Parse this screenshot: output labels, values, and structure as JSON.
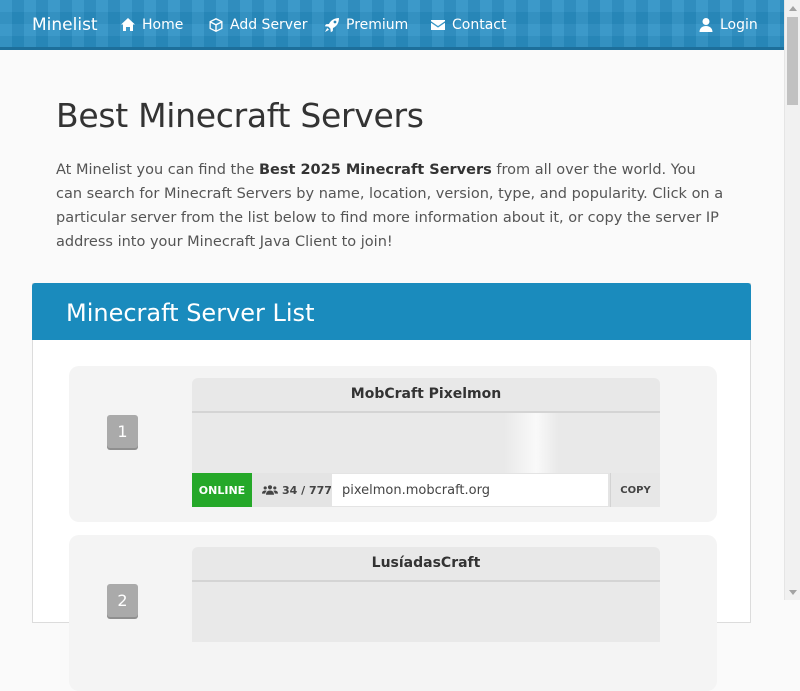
{
  "nav": {
    "brand": "Minelist",
    "items": [
      {
        "label": "Home",
        "icon": "home-icon"
      },
      {
        "label": "Add Server",
        "icon": "cube-icon"
      },
      {
        "label": "Premium",
        "icon": "rocket-icon"
      },
      {
        "label": "Contact",
        "icon": "envelope-icon"
      }
    ],
    "login": "Login"
  },
  "hero": {
    "title": "Best Minecraft Servers",
    "intro_before": "At Minelist you can find the ",
    "intro_bold": "Best 2025 Minecraft Servers",
    "intro_after": " from all over the world. You can search for Minecraft Servers by name, location, version, type, and popularity. Click on a particular server from the list below to find more information about it, or copy the server IP address into your Minecraft Java Client to join!"
  },
  "server_list": {
    "title": "Minecraft Server List",
    "servers": [
      {
        "rank": "1",
        "name": "MobCraft Pixelmon",
        "status": "ONLINE",
        "players": "34 / 777",
        "ip": "pixelmon.mobcraft.org",
        "copy_label": "COPY"
      },
      {
        "rank": "2",
        "name": "LusíadasCraft"
      }
    ]
  },
  "colors": {
    "navbar": "#2a8fc4",
    "panel_header": "#1a8bbd",
    "online": "#25a829"
  }
}
